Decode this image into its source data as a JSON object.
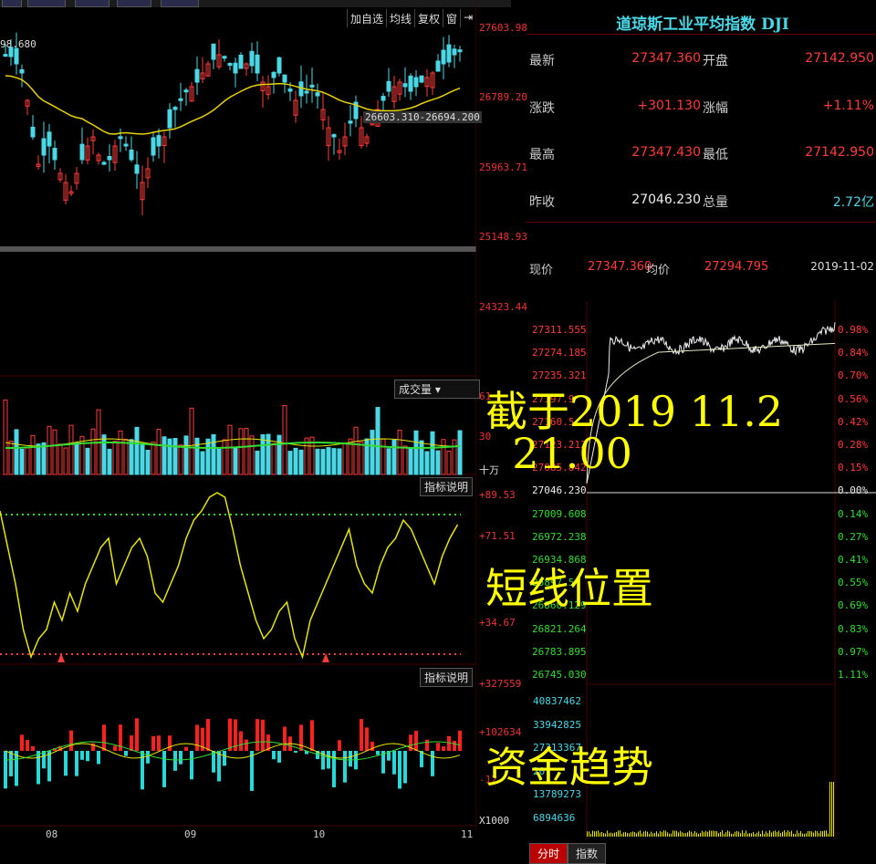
{
  "topbar": {
    "items": [
      "",
      "",
      "",
      "",
      "",
      "",
      "",
      "",
      ""
    ]
  },
  "toolbar": [
    "加自选",
    "均线",
    "复权",
    "窗",
    "⇥"
  ],
  "kline": {
    "ma_readout": "98.680",
    "price_ticks": [
      "27603.98",
      "26789.20",
      "25963.71",
      "25148.93",
      "24323.44"
    ],
    "range_label": "26603.310-26694.200",
    "month_labels": [
      "08",
      "09",
      "10",
      "11"
    ]
  },
  "volume": {
    "dropdown": "成交量",
    "ticks": [
      "61",
      "30",
      "十万"
    ]
  },
  "indicator1": {
    "button": "指标说明",
    "ticks": [
      "+89.53",
      "+71.51",
      "+34.67"
    ]
  },
  "indicator2": {
    "button": "指标说明",
    "ticks": [
      "+327559",
      "+102634",
      "-12"
    ],
    "unit": "X1000"
  },
  "info": {
    "title": "道琼斯工业平均指数 DJI",
    "rows": [
      {
        "l1": "最新",
        "v1": "27347.360",
        "l2": "开盘",
        "v2": "27142.950",
        "c1": "red",
        "c2": "red"
      },
      {
        "l1": "涨跌",
        "v1": "+301.130",
        "l2": "涨幅",
        "v2": "+1.11%",
        "c1": "red",
        "c2": "red"
      },
      {
        "l1": "最高",
        "v1": "27347.430",
        "l2": "最低",
        "v2": "27142.950",
        "c1": "red",
        "c2": "red"
      },
      {
        "l1": "昨收",
        "v1": "27046.230",
        "l2": "总量",
        "v2": "2.72亿",
        "c1": "white",
        "c2": "cyan"
      }
    ],
    "now_label": "现价",
    "now_value": "27347.360",
    "avg_label": "均价",
    "avg_value": "27294.795",
    "date": "2019-11-02"
  },
  "intraday": {
    "left_ticks": [
      "27311.555",
      "27274.185",
      "27235.321",
      "27197.9",
      "27160.5",
      "27123.212",
      "27085.842",
      "27046.230",
      "27009.608",
      "26972.238",
      "26934.868",
      "26897.5",
      "26860.129",
      "26821.264",
      "26783.895",
      "26745.030"
    ],
    "right_ticks": [
      "0.98%",
      "0.84%",
      "0.70%",
      "0.56%",
      "0.42%",
      "0.28%",
      "0.15%",
      "0.00%",
      "0.14%",
      "0.27%",
      "0.41%",
      "0.55%",
      "0.69%",
      "0.83%",
      "0.97%",
      "1.11%"
    ],
    "vol_ticks": [
      "40837462",
      "33942825",
      "27313367",
      "20",
      "13789273",
      "6894636"
    ],
    "tabs": [
      "分时",
      "指数"
    ]
  },
  "overlays": {
    "date_text": "截于2019 11.2\n  21.00",
    "short_pos": "短线位置",
    "capital": "资金趋势"
  }
}
